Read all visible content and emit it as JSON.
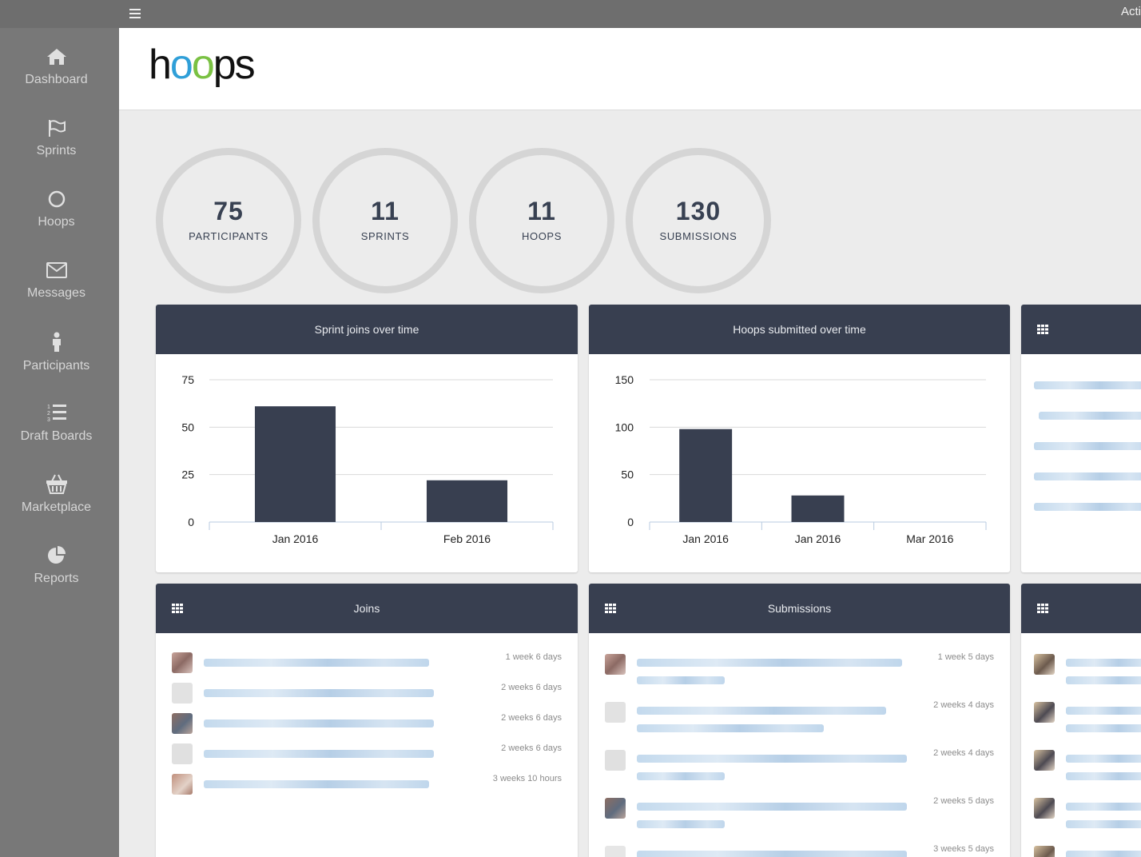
{
  "topbar": {
    "right_text": "Acti"
  },
  "sidebar": {
    "items": [
      {
        "label": "Dashboard",
        "icon": "home-icon"
      },
      {
        "label": "Sprints",
        "icon": "flag-icon"
      },
      {
        "label": "Hoops",
        "icon": "circle-icon"
      },
      {
        "label": "Messages",
        "icon": "envelope-icon"
      },
      {
        "label": "Participants",
        "icon": "person-icon"
      },
      {
        "label": "Draft Boards",
        "icon": "ordered-list-icon"
      },
      {
        "label": "Marketplace",
        "icon": "basket-icon"
      },
      {
        "label": "Reports",
        "icon": "pie-chart-icon"
      }
    ]
  },
  "header": {
    "logo": "hoops"
  },
  "stats": [
    {
      "value": "75",
      "label": "PARTICIPANTS"
    },
    {
      "value": "11",
      "label": "SPRINTS"
    },
    {
      "value": "11",
      "label": "HOOPS"
    },
    {
      "value": "130",
      "label": "SUBMISSIONS"
    }
  ],
  "panels": {
    "sprint_joins_title": "Sprint joins over time",
    "hoops_submitted_title": "Hoops submitted over time",
    "joins_title": "Joins",
    "submissions_title": "Submissions"
  },
  "chart_data": [
    {
      "type": "bar",
      "title": "Sprint joins over time",
      "categories": [
        "Jan 2016",
        "Feb 2016"
      ],
      "values": [
        61,
        22
      ],
      "ylim": [
        0,
        75
      ],
      "yticks": [
        0,
        25,
        50,
        75
      ],
      "color": "#383f50"
    },
    {
      "type": "bar",
      "title": "Hoops submitted over time",
      "categories": [
        "Jan 2016",
        "Jan 2016",
        "Mar 2016"
      ],
      "values": [
        98,
        28,
        0
      ],
      "ylim": [
        0,
        150
      ],
      "yticks": [
        0,
        50,
        100,
        150
      ],
      "color": "#383f50"
    }
  ],
  "joins": [
    {
      "time": "1 week 6 days"
    },
    {
      "time": "2 weeks 6 days"
    },
    {
      "time": "2 weeks 6 days"
    },
    {
      "time": "2 weeks 6 days"
    },
    {
      "time": "3 weeks 10 hours"
    }
  ],
  "submissions": [
    {
      "time": "1 week 5 days"
    },
    {
      "time": "2 weeks 4 days"
    },
    {
      "time": "2 weeks 4 days"
    },
    {
      "time": "2 weeks 5 days"
    },
    {
      "time": "3 weeks 5 days"
    }
  ]
}
